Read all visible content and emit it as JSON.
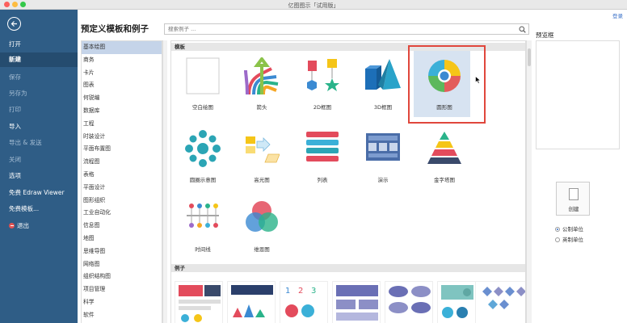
{
  "window": {
    "title": "亿图图示「试用版」"
  },
  "sidebar": {
    "items": [
      {
        "label": "打开"
      },
      {
        "label": "新建"
      },
      {
        "label": "保存"
      },
      {
        "label": "另存为"
      },
      {
        "label": "打印"
      },
      {
        "label": "导入"
      },
      {
        "label": "导出 & 发送"
      },
      {
        "label": "关闭"
      },
      {
        "label": "选项"
      },
      {
        "label": "免费 Edraw Viewer"
      },
      {
        "label": "免费模板..."
      },
      {
        "label": "退出"
      }
    ]
  },
  "main": {
    "heading": "预定义模板和例子",
    "search_placeholder": "搜索例子 ...",
    "login": "登录",
    "categories": [
      "基本绘图",
      "商务",
      "卡片",
      "图表",
      "何锐编",
      "数据库",
      "工程",
      "时装设计",
      "平面布置图",
      "流程图",
      "表格",
      "平面设计",
      "图形组织",
      "工业自动化",
      "信息图",
      "地图",
      "思维导图",
      "网络图",
      "组织结构图",
      "项目管理",
      "科学",
      "软件"
    ],
    "section_templates": "模板",
    "section_examples": "例子",
    "templates": [
      {
        "label": "空白绘图"
      },
      {
        "label": "箭头"
      },
      {
        "label": "2D框图"
      },
      {
        "label": "3D框图"
      },
      {
        "label": "圆形图"
      },
      {
        "label": "圆圈示意图"
      },
      {
        "label": "高光图"
      },
      {
        "label": "列表"
      },
      {
        "label": "演示"
      },
      {
        "label": "金字塔图"
      },
      {
        "label": "时间线"
      },
      {
        "label": "维恩图"
      }
    ]
  },
  "right_panel": {
    "preview_label": "预览框",
    "create_label": "创建",
    "unit_metric": "公制单位",
    "unit_imperial": "英制单位"
  },
  "colors": {
    "sidebar": "#2f5d86",
    "highlight": "#e0473c",
    "selected_category": "#c5d4e9"
  }
}
